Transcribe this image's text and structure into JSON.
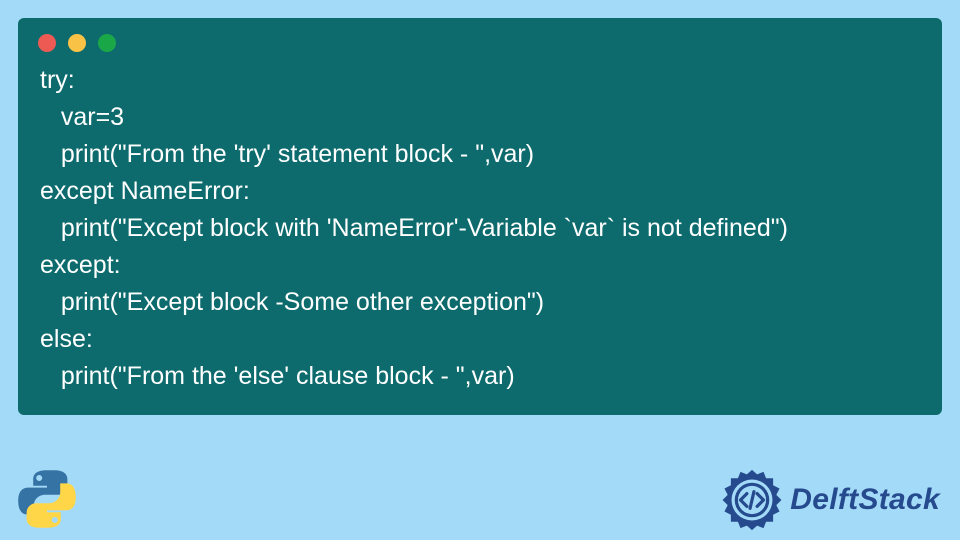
{
  "code": {
    "lines": [
      "try:",
      "   var=3",
      "   print(\"From the 'try' statement block - \",var)",
      "except NameError:",
      "   print(\"Except block with 'NameError'-Variable `var` is not defined\")",
      "except:",
      "   print(\"Except block -Some other exception\")",
      "else:",
      "   print(\"From the 'else' clause block - \",var)"
    ]
  },
  "brand": {
    "name": "DelftStack"
  },
  "window": {
    "dot_red": "#ec5a53",
    "dot_yellow": "#f7c245",
    "dot_green": "#1aa747",
    "bg": "#0d6b6e"
  },
  "colors": {
    "page_bg": "#a3daf7",
    "brand_text": "#254a8e"
  }
}
